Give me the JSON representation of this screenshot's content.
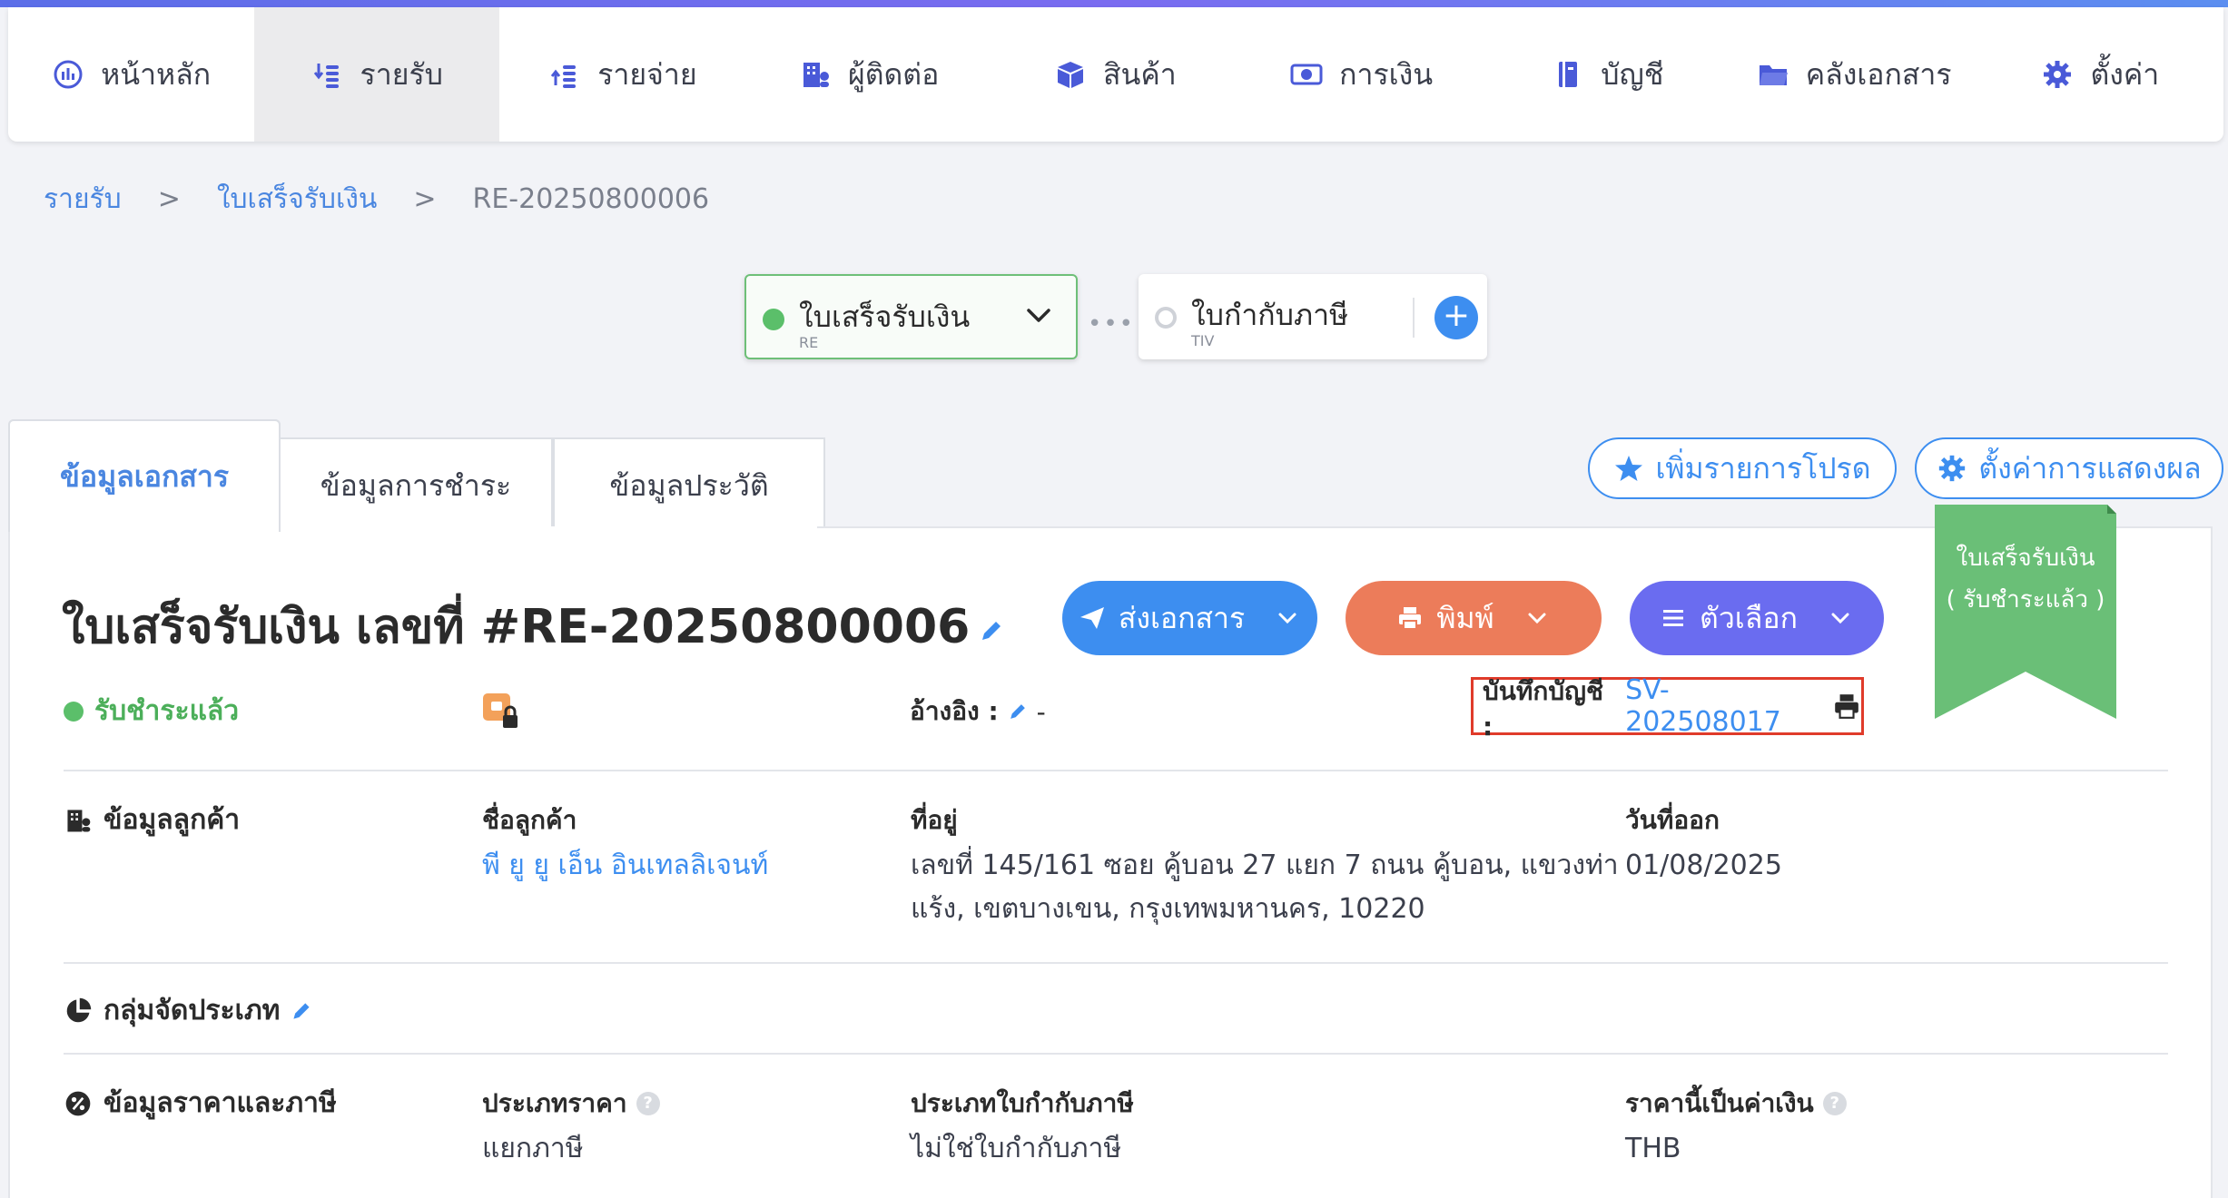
{
  "nav": {
    "items": [
      {
        "label": "หน้าหลัก",
        "icon": "dashboard-icon"
      },
      {
        "label": "รายรับ",
        "icon": "income-icon"
      },
      {
        "label": "รายจ่าย",
        "icon": "expense-icon"
      },
      {
        "label": "ผู้ติดต่อ",
        "icon": "contacts-icon"
      },
      {
        "label": "สินค้า",
        "icon": "box-icon"
      },
      {
        "label": "การเงิน",
        "icon": "money-icon"
      },
      {
        "label": "บัญชี",
        "icon": "ledger-icon"
      },
      {
        "label": "คลังเอกสาร",
        "icon": "folder-icon"
      },
      {
        "label": "ตั้งค่า",
        "icon": "gear-icon"
      }
    ],
    "active": "รายรับ"
  },
  "breadcrumb": {
    "items": [
      "รายรับ",
      "ใบเสร็จรับเงิน"
    ],
    "separator": ">",
    "current": "RE-20250800006"
  },
  "chain": {
    "current": {
      "title": "ใบเสร็จรับเงิน",
      "code": "RE"
    },
    "next": {
      "title": "ใบกำกับภาษี",
      "code": "TIV"
    },
    "connector": "•••",
    "add": "+"
  },
  "tabs": [
    "ข้อมูลเอกสาร",
    "ข้อมูลการชำระ",
    "ข้อมูลประวัติ"
  ],
  "actions": {
    "favorite": "เพิ่มรายการโปรด",
    "display_settings": "ตั้งค่าการแสดงผล"
  },
  "document": {
    "title": "ใบเสร็จรับเงิน เลขที่ #RE-20250800006",
    "buttons": {
      "send": "ส่งเอกสาร",
      "print": "พิมพ์",
      "options": "ตัวเลือก"
    },
    "ribbon": {
      "line1": "ใบเสร็จรับเงิน",
      "line2": "( รับชำระแล้ว )",
      "color": "#6abf77"
    },
    "status": "รับชำระแล้ว",
    "reference": {
      "label": "อ้างอิง :",
      "value": "-"
    },
    "account_entry": {
      "label": "บันทึกบัญชี :",
      "value": "SV-202508017"
    }
  },
  "customer": {
    "section": "ข้อมูลลูกค้า",
    "name_label": "ชื่อลูกค้า",
    "name": "พี ยู ยู เอ็น อินเทลลิเจนท์",
    "address_label": "ที่อยู่",
    "address_line1": "เลขที่ 145/161 ซอย คู้บอน 27 แยก 7 ถนน คู้บอน, แขวงท่า",
    "address_line2": "แร้ง, เขตบางเขน, กรุงเทพมหานคร, 10220",
    "issue_date_label": "วันที่ออก",
    "issue_date": "01/08/2025"
  },
  "category": {
    "section": "กลุ่มจัดประเภท"
  },
  "pricing": {
    "section": "ข้อมูลราคาและภาษี",
    "price_type_label": "ประเภทราคา",
    "price_type": "แยกภาษี",
    "tax_invoice_label": "ประเภทใบกำกับภาษี",
    "tax_invoice": "ไม่ใช่ใบกำกับภาษี",
    "currency_label": "ราคานี้เป็นค่าเงิน",
    "currency": "THB"
  },
  "colors": {
    "accent": "#3d8ef0",
    "success": "#5bbf6a",
    "print": "#ec7c5a",
    "options": "#6a6cf0",
    "highlight": "#e03b2a"
  }
}
